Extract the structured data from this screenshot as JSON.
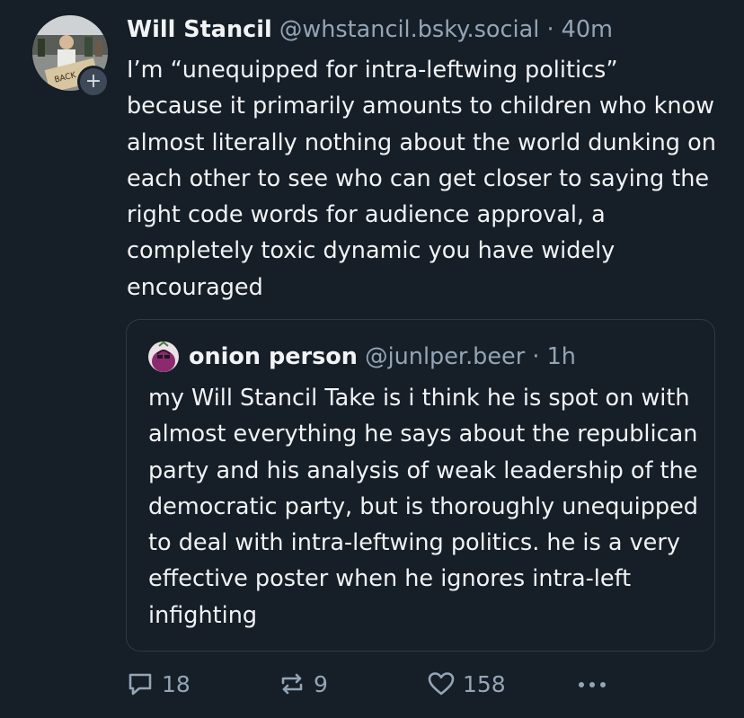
{
  "post": {
    "author": {
      "display_name": "Will Stancil",
      "handle": "@whstancil.bsky.social",
      "avatar_icon": "avatar-photo-protest-sign",
      "follow_icon": "plus-icon",
      "follow_label": "+"
    },
    "separator": "·",
    "time": "40m",
    "text": "I’m “unequipped for intra-leftwing politics” because it primarily amounts to children who know almost literally nothing about the world dunking on each other to see who can get closer to saying the right code words for audience approval, a completely toxic dynamic you have widely encouraged"
  },
  "quote": {
    "author": {
      "display_name": "onion person",
      "handle": "@junlper.beer",
      "avatar_icon": "avatar-onion-cartoon"
    },
    "separator": "·",
    "time": "1h",
    "text": "my Will Stancil Take is i think he is spot on with almost everything he says about the republican party and his analysis of weak leadership of the democratic party, but is thoroughly unequipped to deal with intra-leftwing politics. he is a very effective poster when he ignores intra-left infighting"
  },
  "actions": {
    "reply": {
      "icon": "reply-bubble-icon",
      "count": "18"
    },
    "repost": {
      "icon": "repost-arrows-icon",
      "count": "9"
    },
    "like": {
      "icon": "heart-icon",
      "count": "158"
    },
    "more": {
      "icon": "ellipsis-icon"
    }
  },
  "colors": {
    "background": "#161e27",
    "text": "#f1f3f5",
    "muted": "#93a5b7",
    "border": "#2c3a4a"
  }
}
